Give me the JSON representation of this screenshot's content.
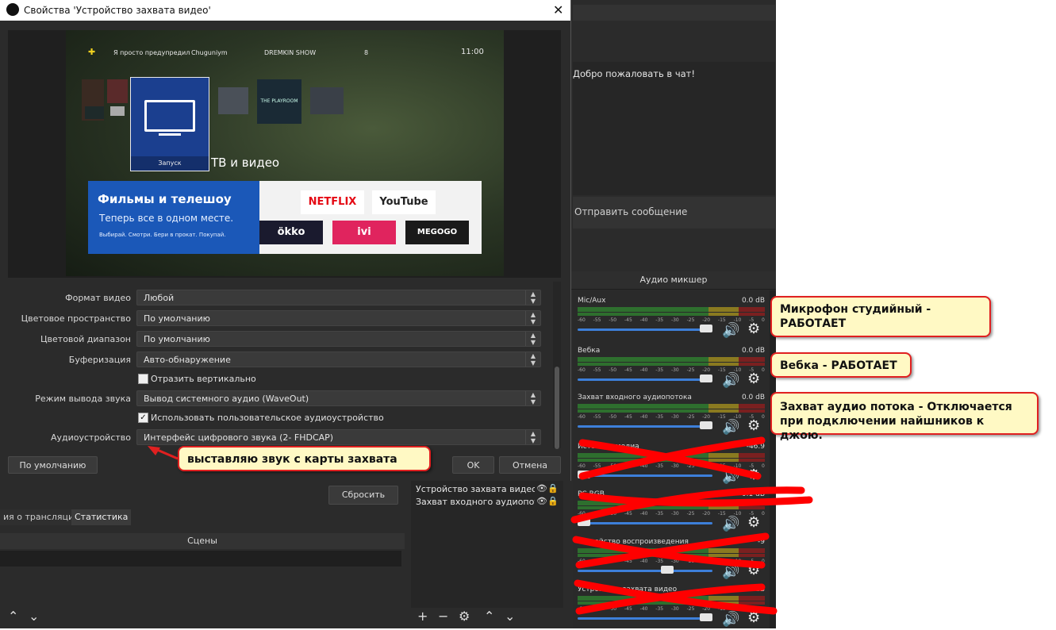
{
  "dialog": {
    "title": "Свойства 'Устройство захвата видео'",
    "close_label": "✕",
    "preview": {
      "status_items": [
        "Я просто предупредил",
        "Chuguniym",
        "DREMKIN SHOW",
        "8",
        "11:00"
      ],
      "tile_main_label": "Запуск",
      "tile_tv_label": "ТВ и видео",
      "tile_side_text": "THE PLAYROOM",
      "banner_title": "Фильмы и телешоу",
      "banner_subtitle": "Теперь все в одном месте.",
      "banner_small": "Выбирай. Смотри. Бери в прокат. Покупай.",
      "logos": [
        "NETFLIX",
        "YouTube",
        "ökko",
        "ivi",
        "MEGOGO"
      ]
    },
    "form": {
      "video_format_label": "Формат видео",
      "video_format_value": "Любой",
      "color_space_label": "Цветовое пространство",
      "color_space_value": "По умолчанию",
      "color_range_label": "Цветовой диапазон",
      "color_range_value": "По умолчанию",
      "buffering_label": "Буферизация",
      "buffering_value": "Авто-обнаружение",
      "flip_label": "Отразить вертикально",
      "flip_checked": false,
      "audio_mode_label": "Режим вывода звука",
      "audio_mode_value": "Вывод системного аудио (WaveOut)",
      "custom_audio_label": "Использовать пользовательское аудиоустройство",
      "custom_audio_checked": true,
      "audio_device_label": "Аудиоустройство",
      "audio_device_value": "Интерфейс цифрового звука (2- FHDCAP)"
    },
    "buttons": {
      "defaults": "По умолчанию",
      "ok": "OK",
      "cancel": "Отмена"
    }
  },
  "main": {
    "reset_label": "Сбросить",
    "tabs": [
      "ия о трансляции",
      "Статистика"
    ],
    "scenes_title": "Сцены",
    "sources": [
      "Устройство захвата видео",
      "Захват входного аудиопотока"
    ]
  },
  "chat": {
    "welcome": "Добро пожаловать в чат!",
    "send_label": "Отправить сообщение"
  },
  "mixer": {
    "title": "Аудио микшер",
    "ticks": [
      "-60",
      "-55",
      "-50",
      "-45",
      "-40",
      "-35",
      "-30",
      "-25",
      "-20",
      "-15",
      "-10",
      "-5",
      "0"
    ],
    "channels": [
      {
        "name": "Mic/Aux",
        "db": "0.0 dB",
        "level": 1.0
      },
      {
        "name": "Вебка",
        "db": "0.0 dB",
        "level": 1.0
      },
      {
        "name": "Захват входного аудиопотока",
        "db": "0.0 dB",
        "level": 1.0
      },
      {
        "name": "Источник медиа",
        "db": "-46.9",
        "level": 0.0
      },
      {
        "name": "PC RGB",
        "db": "-0.1 dB",
        "level": 0.0
      },
      {
        "name": "Устройство воспроизведения",
        "db": "-9",
        "level": 0.68
      },
      {
        "name": "Устройство захвата видео",
        "db": "0.0 dB",
        "level": 1.0
      }
    ]
  },
  "annotations": {
    "mic": "Микрофон студийный - РАБОТАЕТ",
    "webcam": "Вебка - РАБОТАЕТ",
    "capture": "Захват аудио потока - Отключается при подключении найшников к джою.",
    "device": "выставляю звук с карты захвата",
    "accent": "#e02020"
  }
}
